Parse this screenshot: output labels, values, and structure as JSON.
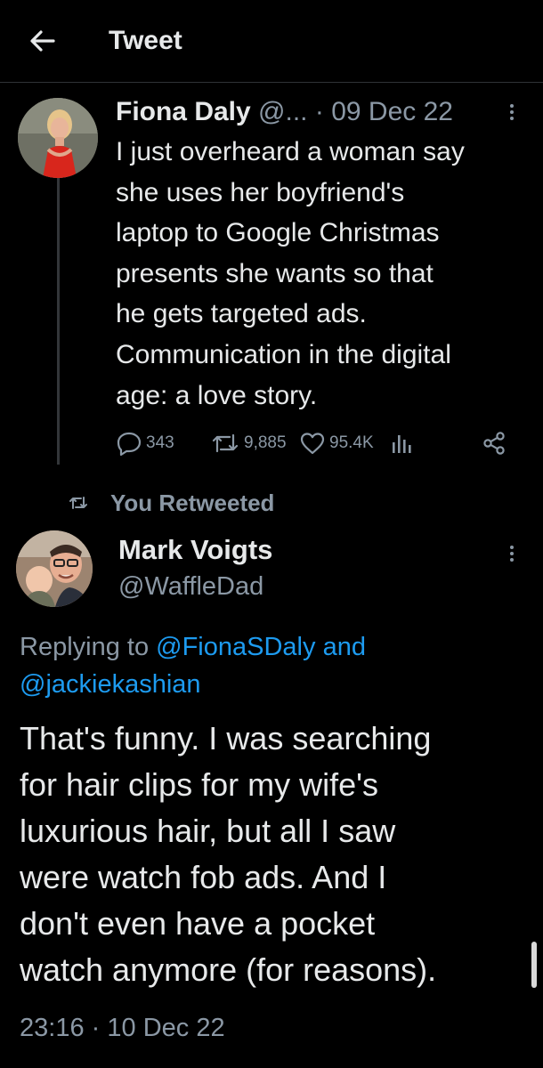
{
  "header": {
    "title": "Tweet",
    "back_icon": "arrow-left-icon"
  },
  "original_tweet": {
    "author_name": "Fiona Daly",
    "author_handle": "@...",
    "separator": "·",
    "date": "09 Dec 22",
    "text_lines": [
      "I just overheard a woman say",
      "she uses her boyfriend's",
      "laptop to Google Christmas",
      "presents she wants so that",
      "he gets targeted ads.",
      "Communication in the digital",
      "age: a love story."
    ],
    "replies": "343",
    "retweets": "9,885",
    "likes": "95.4K"
  },
  "retweet_label": "You Retweeted",
  "reply_tweet": {
    "author_name": "Mark Voigts",
    "author_handle": "@WaffleDad",
    "replying_prefix": "Replying to",
    "mention_1": "@FionaSDaly",
    "and_word": "and",
    "mention_2": "@jackiekashian",
    "text_lines": [
      "That's funny. I was searching",
      "for hair clips for my wife's",
      "luxurious hair, but all I saw",
      "were watch fob ads. And I",
      "don't even have a pocket",
      "watch anymore (for reasons)."
    ],
    "time": "23:16",
    "separator": "·",
    "date": "10 Dec 22"
  },
  "colors": {
    "background": "#000000",
    "text": "#e7e9ea",
    "muted": "#8b98a5",
    "accent": "#1d9bf0"
  }
}
